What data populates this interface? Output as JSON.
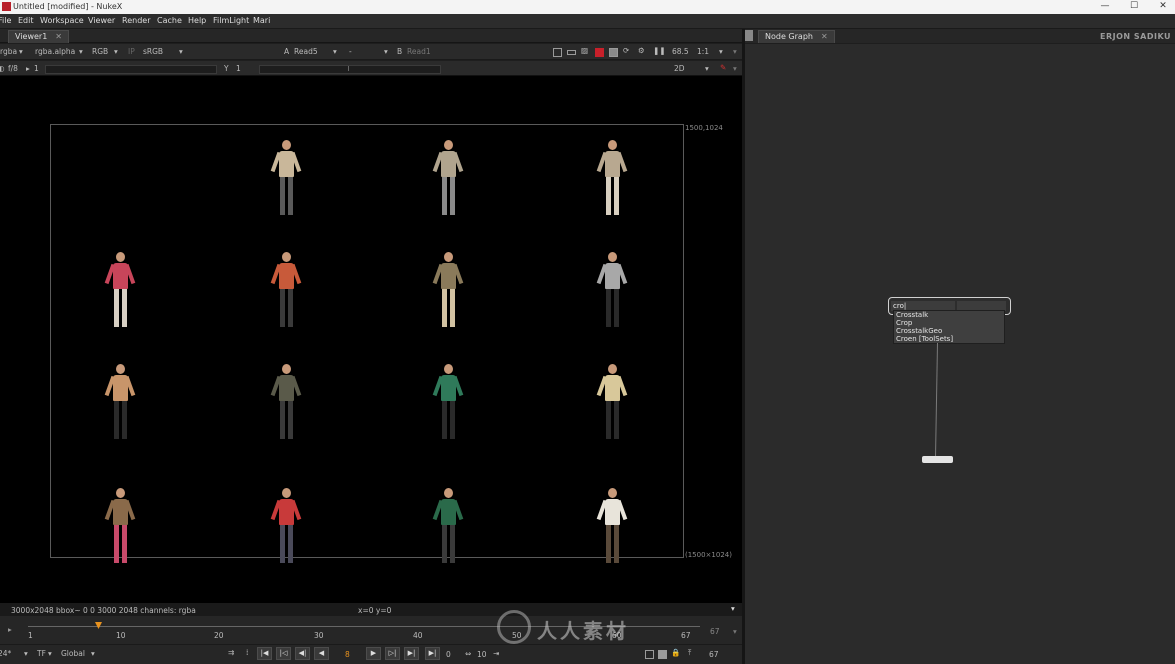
{
  "window": {
    "title": "Untitled [modified] - NukeX"
  },
  "menu": [
    "File",
    "Edit",
    "Workspace",
    "Viewer",
    "Render",
    "Cache",
    "Help",
    "FilmLight",
    "Mari"
  ],
  "viewer": {
    "tab_label": "Viewer1",
    "channels": "rgba",
    "alpha": "rgba.alpha",
    "display": "RGB",
    "lut": "sRGB",
    "input_a_label": "A",
    "input_a": "Read5",
    "input_dash": "-",
    "input_b_label": "B",
    "input_b": "Read1",
    "zoom": "68.5",
    "ratio": "1:1",
    "fstop": "f/8",
    "gain": "1",
    "gamma_label": "Y",
    "gamma": "1",
    "mode": "2D",
    "format_top_right": "1500,1024",
    "format_bottom_right": "(1500×1024)"
  },
  "status": {
    "info": "3000x2048  bbox~ 0 0 3000 2048 channels: rgba",
    "coords": "x=0 y=0"
  },
  "timeline": {
    "ticks": [
      "1",
      "10",
      "20",
      "30",
      "40",
      "50",
      "60",
      "67"
    ],
    "current_frame": "8",
    "end_frame": "67",
    "increment": "10",
    "fps": "24*",
    "tf": "TF",
    "range_mode": "Global"
  },
  "node_graph": {
    "tab_label": "Node Graph",
    "user_name": "ERJON SADIKU",
    "search_value": "cro|",
    "results": [
      "Crosstalk",
      "Crop",
      "CrosstalkGeo",
      "Croen [ToolSets]"
    ]
  },
  "colors": {
    "accent_playhead": "#e8921e",
    "app_icon": "#b8202a",
    "viewer_bg": "#000000",
    "panel_bg": "#2b2b2b"
  },
  "icons": [
    "viewer-toolbar-icons",
    "playback-controls",
    "close-icon",
    "minimize-icon",
    "maximize-icon"
  ],
  "watermark": {
    "text": "人人素材"
  }
}
